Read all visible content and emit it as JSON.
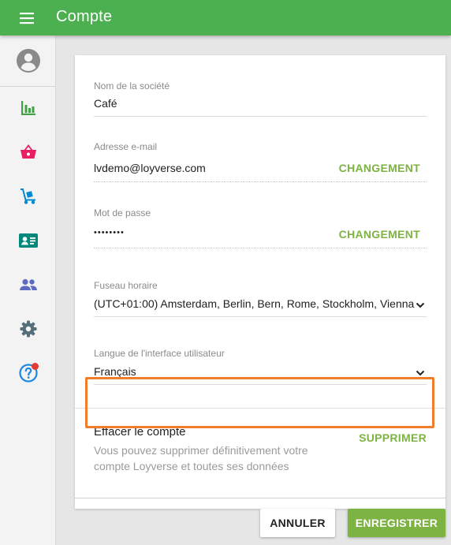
{
  "app": {
    "title": "Compte"
  },
  "colors": {
    "primary": "#4caf50",
    "accent": "#7cb342",
    "highlight": "#ef7d2c",
    "badge": "#e53935"
  },
  "sidebar": {
    "items": [
      {
        "name": "account",
        "icon": "account-circle-icon"
      },
      {
        "name": "reports",
        "icon": "bar-chart-icon"
      },
      {
        "name": "items",
        "icon": "basket-icon"
      },
      {
        "name": "inventory",
        "icon": "hand-truck-icon"
      },
      {
        "name": "employees",
        "icon": "id-card-icon"
      },
      {
        "name": "customers",
        "icon": "people-icon"
      },
      {
        "name": "settings",
        "icon": "gear-icon"
      },
      {
        "name": "help",
        "icon": "help-circle-icon",
        "has_notification": true
      }
    ]
  },
  "form": {
    "company": {
      "label": "Nom de la société",
      "value": "Café"
    },
    "email": {
      "label": "Adresse e-mail",
      "value": "lvdemo@loyverse.com",
      "action": "CHANGEMENT"
    },
    "password": {
      "label": "Mot de passe",
      "value": "••••••••",
      "action": "CHANGEMENT"
    },
    "timezone": {
      "label": "Fuseau horaire",
      "value": "(UTC+01:00) Amsterdam, Berlin, Bern, Rome, Stockholm, Vienna"
    },
    "language": {
      "label": "Langue de l'interface utilisateur",
      "value": "Français"
    }
  },
  "delete_account": {
    "title": "Effacer le compte",
    "description": "Vous pouvez supprimer définitivement votre compte Loyverse et toutes ses données",
    "action": "SUPPRIMER"
  },
  "footer": {
    "cancel_label": "ANNULER",
    "save_label": "ENREGISTRER"
  }
}
